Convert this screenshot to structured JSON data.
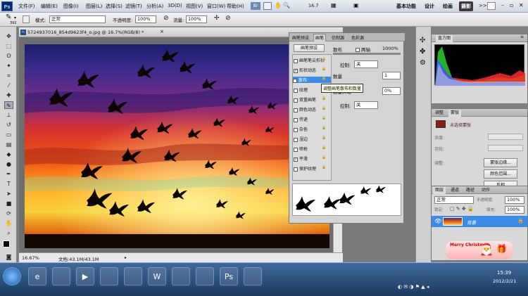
{
  "menubar": {
    "logo": "Ps",
    "items": [
      "文件(F)",
      "编辑(E)",
      "图像(I)",
      "图层(L)",
      "选择(S)",
      "滤镜(T)",
      "分析(A)",
      "3D(D)",
      "视图(V)",
      "窗口(W)",
      "帮助(H)"
    ],
    "zoom": "16.7",
    "workspaces": [
      "基本功能",
      "设计",
      "绘画",
      "摄影"
    ],
    "selected_workspace": "摄影",
    "overflow": ">>"
  },
  "options": {
    "brush_size": "392",
    "mode_label": "模式:",
    "mode_value": "正常",
    "opacity_label": "不透明度:",
    "opacity_value": "100%",
    "flow_label": "流量:",
    "flow_value": "100%"
  },
  "document": {
    "tab_title": "5724937016_854d9623f4_o.jpg @ 16.7%(RGB/8) *",
    "zoom": "16.67%",
    "status": "文档:43.1M/43.1M"
  },
  "brush_panel": {
    "tabs": [
      "画笔预设",
      "画笔",
      "仿制源",
      "色彩源"
    ],
    "selected_tab": "画笔",
    "preset_button": "画笔预设",
    "options": [
      {
        "label": "画笔笔尖形状",
        "checked": false
      },
      {
        "label": "形状动态",
        "checked": true
      },
      {
        "label": "散布",
        "checked": true
      },
      {
        "label": "纹理",
        "checked": false
      },
      {
        "label": "双重画笔",
        "checked": false
      },
      {
        "label": "颜色动态",
        "checked": false
      },
      {
        "label": "传递",
        "checked": false
      },
      {
        "label": "杂色",
        "checked": false
      },
      {
        "label": "湿边",
        "checked": false
      },
      {
        "label": "喷枪",
        "checked": false
      },
      {
        "label": "平滑",
        "checked": true
      },
      {
        "label": "保护纹理",
        "checked": false
      }
    ],
    "scatter_label": "散布",
    "both_axes": "两轴",
    "scatter_value": "1000%",
    "control_label": "控制:",
    "control_value": "关",
    "count_label": "数量",
    "count_value": "1",
    "count_jitter_label": "数量抖动",
    "count_jitter_value": "0%",
    "tooltip": "调整画笔散布和数量"
  },
  "histogram": {
    "tabs": [
      "直方图"
    ],
    "colors": [
      "#ff2a2a",
      "#2ad12a",
      "#2a5aff",
      "#ffffff"
    ]
  },
  "adjustments": {
    "tabs": [
      "调整",
      "蒙版"
    ],
    "no_selection": "未选择蒙版",
    "density": "浓度:",
    "feather": "羽化:",
    "refine_label": "调整:",
    "buttons": [
      "蒙版边缘...",
      "颜色范围...",
      "反相"
    ]
  },
  "layers": {
    "tabs": [
      "图层",
      "通道",
      "路径",
      "动作"
    ],
    "blend": "正常",
    "opacity_label": "不透明度:",
    "opacity_value": "100%",
    "lock_label": "锁定:",
    "fill_label": "填充:",
    "fill_value": "100%",
    "layer_name": "背景"
  },
  "sticker": {
    "text": "Merry Christmas"
  },
  "taskbar": {
    "icons": [
      "windows-icon",
      "ie-icon",
      "folder-icon",
      "media-icon",
      "app-icon",
      "chrome-icon",
      "wps-icon",
      "paint-icon",
      "qq-icon",
      "photoshop-icon",
      "tool-icon"
    ],
    "labels": [
      "",
      "e",
      "",
      "▶",
      "",
      "",
      "W",
      "",
      "",
      "Ps",
      ""
    ],
    "time": "15:39",
    "date": "2012/2/21"
  }
}
